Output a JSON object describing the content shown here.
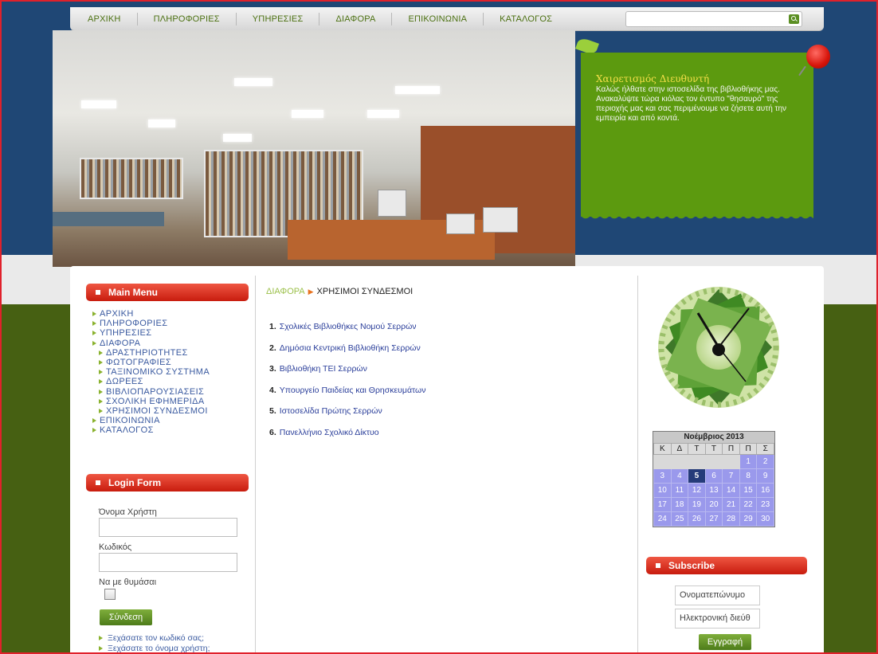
{
  "nav": {
    "items": [
      "ΑΡΧΙΚΗ",
      "ΠΛΗΡΟΦΟΡΙΕΣ",
      "ΥΠΗΡΕΣΙΕΣ",
      "ΔΙΑΦΟΡΑ",
      "ΕΠΙΚΟΙΝΩΝΙΑ",
      "ΚΑΤΑΛΟΓΟΣ"
    ],
    "search_value": ""
  },
  "note": {
    "title": "Χαιρετισμός Διευθυντή",
    "text": "Καλώς ήλθατε στην ιστοσελίδα της βιβλιοθήκης μας. Ανακαλύψτε τώρα κιόλας τον έντυπο \"θησαυρό\" της περιοχής μας και σας περιμένουμε να ζήσετε αυτή την εμπειρία και από κοντά."
  },
  "main_menu": {
    "title": "Main Menu",
    "items": [
      "ΑΡΧΙΚΗ",
      "ΠΛΗΡΟΦΟΡΙΕΣ",
      "ΥΠΗΡΕΣΙΕΣ",
      "ΔΙΑΦΟΡΑ",
      "ΔΡΑΣΤΗΡΙΟΤΗΤΕΣ",
      "ΦΩΤΟΓΡΑΦΙΕΣ",
      "ΤΑΞΙΝΟΜΙΚΟ ΣΥΣΤΗΜΑ",
      "ΔΩΡΕΕΣ",
      "ΒΙΒΛΙΟΠΑΡΟΥΣΙΑΣΕΙΣ",
      "ΣΧΟΛΙΚΗ ΕΦΗΜΕΡΙΔΑ",
      "ΧΡΗΣΙΜΟΙ ΣΥΝΔΕΣΜΟΙ",
      "ΕΠΙΚΟΙΝΩΝΙΑ",
      "ΚΑΤΑΛΟΓΟΣ"
    ]
  },
  "login": {
    "title": "Login Form",
    "username_label": "Όνομα Χρήστη",
    "username_value": "",
    "password_label": "Κωδικός",
    "password_value": "",
    "remember_label": "Να με θυμάσαι",
    "submit_label": "Σύνδεση",
    "forgot_password": "Ξεχάσατε τον κωδικό σας;",
    "forgot_username": "Ξεχάσατε το όνομα χρήστη;"
  },
  "breadcrumb": {
    "parent": "ΔΙΑΦΟΡΑ",
    "current": "ΧΡΗΣΙΜΟΙ ΣΥΝΔΕΣΜΟΙ"
  },
  "links": [
    {
      "num": "1.",
      "text": "Σχολικές Βιβλιοθήκες Νομού Σερρών"
    },
    {
      "num": "2.",
      "text": "Δημόσια Κεντρική Βιβλιοθήκη Σερρών"
    },
    {
      "num": "3.",
      "text": "Βιβλιοθήκη ΤΕΙ Σερρών"
    },
    {
      "num": "4.",
      "text": "Υπουργείο Παιδείας και Θρησκευμάτων"
    },
    {
      "num": "5.",
      "text": "Ιστοσελίδα Πρώτης Σερρών"
    },
    {
      "num": "6.",
      "text": "Πανελλήνιο Σχολικό Δίκτυο"
    }
  ],
  "calendar": {
    "title": "Νοέμβριος 2013",
    "weekdays": [
      "Κ",
      "Δ",
      "Τ",
      "Τ",
      "Π",
      "Π",
      "Σ"
    ],
    "weeks": [
      [
        "",
        "",
        "",
        "",
        "",
        "1",
        "2"
      ],
      [
        "3",
        "4",
        "5",
        "6",
        "7",
        "8",
        "9"
      ],
      [
        "10",
        "11",
        "12",
        "13",
        "14",
        "15",
        "16"
      ],
      [
        "17",
        "18",
        "19",
        "20",
        "21",
        "22",
        "23"
      ],
      [
        "24",
        "25",
        "26",
        "27",
        "28",
        "29",
        "30"
      ]
    ],
    "today": "5"
  },
  "subscribe": {
    "title": "Subscribe",
    "name_placeholder": "Ονοματεπώνυμο",
    "email_placeholder": "Ηλεκτρονική διεύθ",
    "submit_label": "Εγγραφή"
  },
  "colors": {
    "accent_green": "#5c9a0f",
    "header_blue": "#1f4775",
    "module_red": "#d7281a",
    "calendar_blue": "#9a99ec"
  }
}
